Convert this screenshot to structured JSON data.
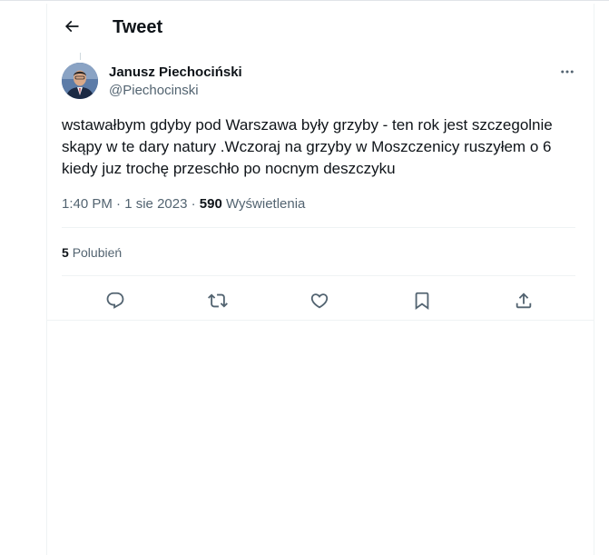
{
  "header": {
    "title": "Tweet",
    "back_icon": "arrow-left-icon"
  },
  "tweet": {
    "author": {
      "name": "Janusz Piechociński",
      "handle": "@Piechocinski"
    },
    "text_lines": [
      "wstawałbym gdyby pod Warszawa były grzyby - ten rok jest szczegolnie",
      "skąpy w te dary natury .Wczoraj na grzyby w Moszczenicy ruszyłem o 6",
      "kiedy juz trochę przeschło po nocnym deszczyku"
    ],
    "time": "1:40 PM",
    "date": "1 sie 2023",
    "views_count": "590",
    "views_label": "Wyświetlenia",
    "likes_count": "5",
    "likes_label": "Polubień"
  },
  "actions": {
    "reply_icon": "reply-icon",
    "retweet_icon": "retweet-icon",
    "like_icon": "heart-icon",
    "bookmark_icon": "bookmark-icon",
    "share_icon": "share-icon"
  },
  "colors": {
    "text_primary": "#0f1419",
    "text_secondary": "#536471",
    "divider": "#eff3f4"
  }
}
